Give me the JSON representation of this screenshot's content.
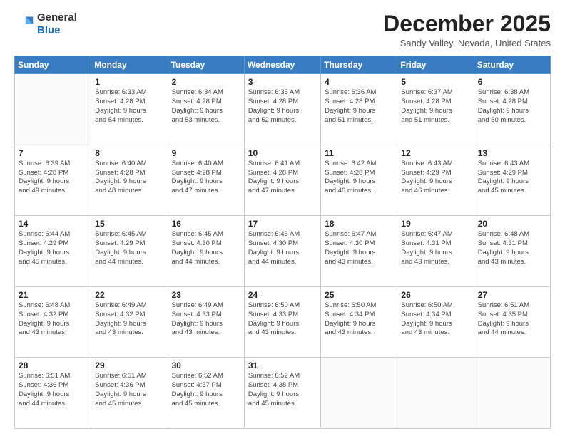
{
  "header": {
    "logo_line1": "General",
    "logo_line2": "Blue",
    "month_title": "December 2025",
    "location": "Sandy Valley, Nevada, United States"
  },
  "days_of_week": [
    "Sunday",
    "Monday",
    "Tuesday",
    "Wednesday",
    "Thursday",
    "Friday",
    "Saturday"
  ],
  "weeks": [
    [
      {
        "day": "",
        "info": ""
      },
      {
        "day": "1",
        "info": "Sunrise: 6:33 AM\nSunset: 4:28 PM\nDaylight: 9 hours\nand 54 minutes."
      },
      {
        "day": "2",
        "info": "Sunrise: 6:34 AM\nSunset: 4:28 PM\nDaylight: 9 hours\nand 53 minutes."
      },
      {
        "day": "3",
        "info": "Sunrise: 6:35 AM\nSunset: 4:28 PM\nDaylight: 9 hours\nand 52 minutes."
      },
      {
        "day": "4",
        "info": "Sunrise: 6:36 AM\nSunset: 4:28 PM\nDaylight: 9 hours\nand 51 minutes."
      },
      {
        "day": "5",
        "info": "Sunrise: 6:37 AM\nSunset: 4:28 PM\nDaylight: 9 hours\nand 51 minutes."
      },
      {
        "day": "6",
        "info": "Sunrise: 6:38 AM\nSunset: 4:28 PM\nDaylight: 9 hours\nand 50 minutes."
      }
    ],
    [
      {
        "day": "7",
        "info": "Sunrise: 6:39 AM\nSunset: 4:28 PM\nDaylight: 9 hours\nand 49 minutes."
      },
      {
        "day": "8",
        "info": "Sunrise: 6:40 AM\nSunset: 4:28 PM\nDaylight: 9 hours\nand 48 minutes."
      },
      {
        "day": "9",
        "info": "Sunrise: 6:40 AM\nSunset: 4:28 PM\nDaylight: 9 hours\nand 47 minutes."
      },
      {
        "day": "10",
        "info": "Sunrise: 6:41 AM\nSunset: 4:28 PM\nDaylight: 9 hours\nand 47 minutes."
      },
      {
        "day": "11",
        "info": "Sunrise: 6:42 AM\nSunset: 4:28 PM\nDaylight: 9 hours\nand 46 minutes."
      },
      {
        "day": "12",
        "info": "Sunrise: 6:43 AM\nSunset: 4:29 PM\nDaylight: 9 hours\nand 46 minutes."
      },
      {
        "day": "13",
        "info": "Sunrise: 6:43 AM\nSunset: 4:29 PM\nDaylight: 9 hours\nand 45 minutes."
      }
    ],
    [
      {
        "day": "14",
        "info": "Sunrise: 6:44 AM\nSunset: 4:29 PM\nDaylight: 9 hours\nand 45 minutes."
      },
      {
        "day": "15",
        "info": "Sunrise: 6:45 AM\nSunset: 4:29 PM\nDaylight: 9 hours\nand 44 minutes."
      },
      {
        "day": "16",
        "info": "Sunrise: 6:45 AM\nSunset: 4:30 PM\nDaylight: 9 hours\nand 44 minutes."
      },
      {
        "day": "17",
        "info": "Sunrise: 6:46 AM\nSunset: 4:30 PM\nDaylight: 9 hours\nand 44 minutes."
      },
      {
        "day": "18",
        "info": "Sunrise: 6:47 AM\nSunset: 4:30 PM\nDaylight: 9 hours\nand 43 minutes."
      },
      {
        "day": "19",
        "info": "Sunrise: 6:47 AM\nSunset: 4:31 PM\nDaylight: 9 hours\nand 43 minutes."
      },
      {
        "day": "20",
        "info": "Sunrise: 6:48 AM\nSunset: 4:31 PM\nDaylight: 9 hours\nand 43 minutes."
      }
    ],
    [
      {
        "day": "21",
        "info": "Sunrise: 6:48 AM\nSunset: 4:32 PM\nDaylight: 9 hours\nand 43 minutes."
      },
      {
        "day": "22",
        "info": "Sunrise: 6:49 AM\nSunset: 4:32 PM\nDaylight: 9 hours\nand 43 minutes."
      },
      {
        "day": "23",
        "info": "Sunrise: 6:49 AM\nSunset: 4:33 PM\nDaylight: 9 hours\nand 43 minutes."
      },
      {
        "day": "24",
        "info": "Sunrise: 6:50 AM\nSunset: 4:33 PM\nDaylight: 9 hours\nand 43 minutes."
      },
      {
        "day": "25",
        "info": "Sunrise: 6:50 AM\nSunset: 4:34 PM\nDaylight: 9 hours\nand 43 minutes."
      },
      {
        "day": "26",
        "info": "Sunrise: 6:50 AM\nSunset: 4:34 PM\nDaylight: 9 hours\nand 43 minutes."
      },
      {
        "day": "27",
        "info": "Sunrise: 6:51 AM\nSunset: 4:35 PM\nDaylight: 9 hours\nand 44 minutes."
      }
    ],
    [
      {
        "day": "28",
        "info": "Sunrise: 6:51 AM\nSunset: 4:36 PM\nDaylight: 9 hours\nand 44 minutes."
      },
      {
        "day": "29",
        "info": "Sunrise: 6:51 AM\nSunset: 4:36 PM\nDaylight: 9 hours\nand 45 minutes."
      },
      {
        "day": "30",
        "info": "Sunrise: 6:52 AM\nSunset: 4:37 PM\nDaylight: 9 hours\nand 45 minutes."
      },
      {
        "day": "31",
        "info": "Sunrise: 6:52 AM\nSunset: 4:38 PM\nDaylight: 9 hours\nand 45 minutes."
      },
      {
        "day": "",
        "info": ""
      },
      {
        "day": "",
        "info": ""
      },
      {
        "day": "",
        "info": ""
      }
    ]
  ]
}
